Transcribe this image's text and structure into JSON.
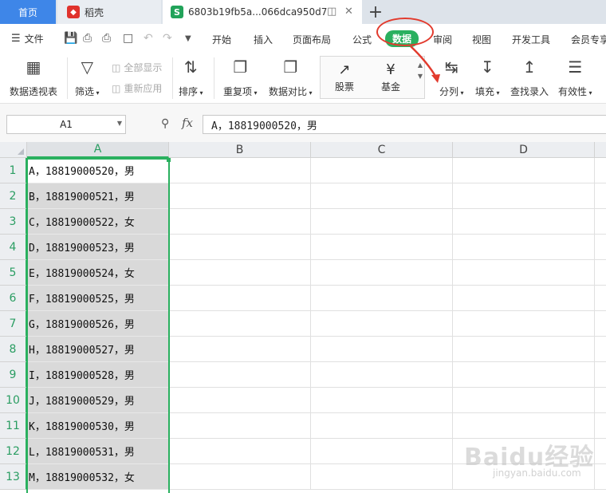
{
  "tabs": {
    "home": "首页",
    "docer": "稻壳",
    "file": "6803b19fb5a...066dca950d7",
    "file_icon": "S",
    "add": "+"
  },
  "menu": {
    "file": "文件",
    "items": [
      "开始",
      "插入",
      "页面布局",
      "公式",
      "数据",
      "审阅",
      "视图",
      "开发工具",
      "会员专享"
    ],
    "active": "数据"
  },
  "ribbon": {
    "pivot": "数据透视表",
    "filter": "筛选",
    "show_all": "全部显示",
    "reapply": "重新应用",
    "sort": "排序",
    "duplicates": "重复项",
    "compare": "数据对比",
    "stocks": "股票",
    "funds": "基金",
    "split": "分列",
    "fill": "填充",
    "lookup": "查找录入",
    "validity": "有效性"
  },
  "formula_bar": {
    "name_box": "A1",
    "fx_label": "fx",
    "formula": "A，18819000520，男"
  },
  "grid": {
    "columns": [
      "A",
      "B",
      "C",
      "D"
    ],
    "selected_column": "A",
    "row_numbers": [
      "1",
      "2",
      "3",
      "4",
      "5",
      "6",
      "7",
      "8",
      "9",
      "10",
      "11",
      "12",
      "13"
    ],
    "cells_A": [
      "A，18819000520，男",
      "B，18819000521，男",
      "C，18819000522，女",
      "D，18819000523，男",
      "E，18819000524，女",
      "F，18819000525，男",
      "G，18819000526，男",
      "H，18819000527，男",
      "I，18819000528，男",
      "J，18819000529，男",
      "K，18819000530，男",
      "L，18819000531，男",
      "M，18819000532，女"
    ]
  },
  "watermark": {
    "brand": "Baidu经验",
    "url": "jingyan.baidu.com"
  },
  "colors": {
    "accent_green": "#2ab05f",
    "annotation_red": "#e23b2e",
    "home_tab_blue": "#3e86e8"
  }
}
